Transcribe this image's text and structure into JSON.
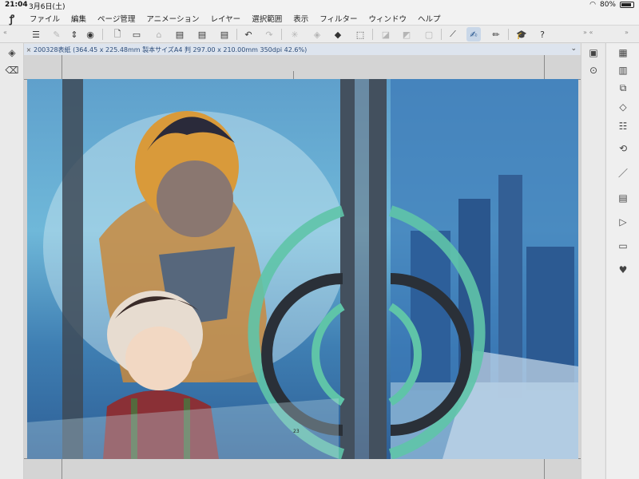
{
  "status": {
    "time": "21:04",
    "date": "3月6日(土)",
    "wifi": "wifi-icon",
    "battery": "80%"
  },
  "menu": [
    "ファイル",
    "編集",
    "ページ管理",
    "アニメーション",
    "レイヤー",
    "選択範囲",
    "表示",
    "フィルター",
    "ウィンドウ",
    "ヘルプ"
  ],
  "tab": {
    "title": "200328表紙 (364.45 x 225.48mm 製本サイズA4 判 297.00 x 210.00mm 350dpi 42.6%)"
  },
  "canvas": {
    "page_number": "23"
  },
  "colors": {
    "accent": "#1e4f8a",
    "tab_bg": "#dde4ee",
    "toolbar_bg": "#ececec"
  }
}
